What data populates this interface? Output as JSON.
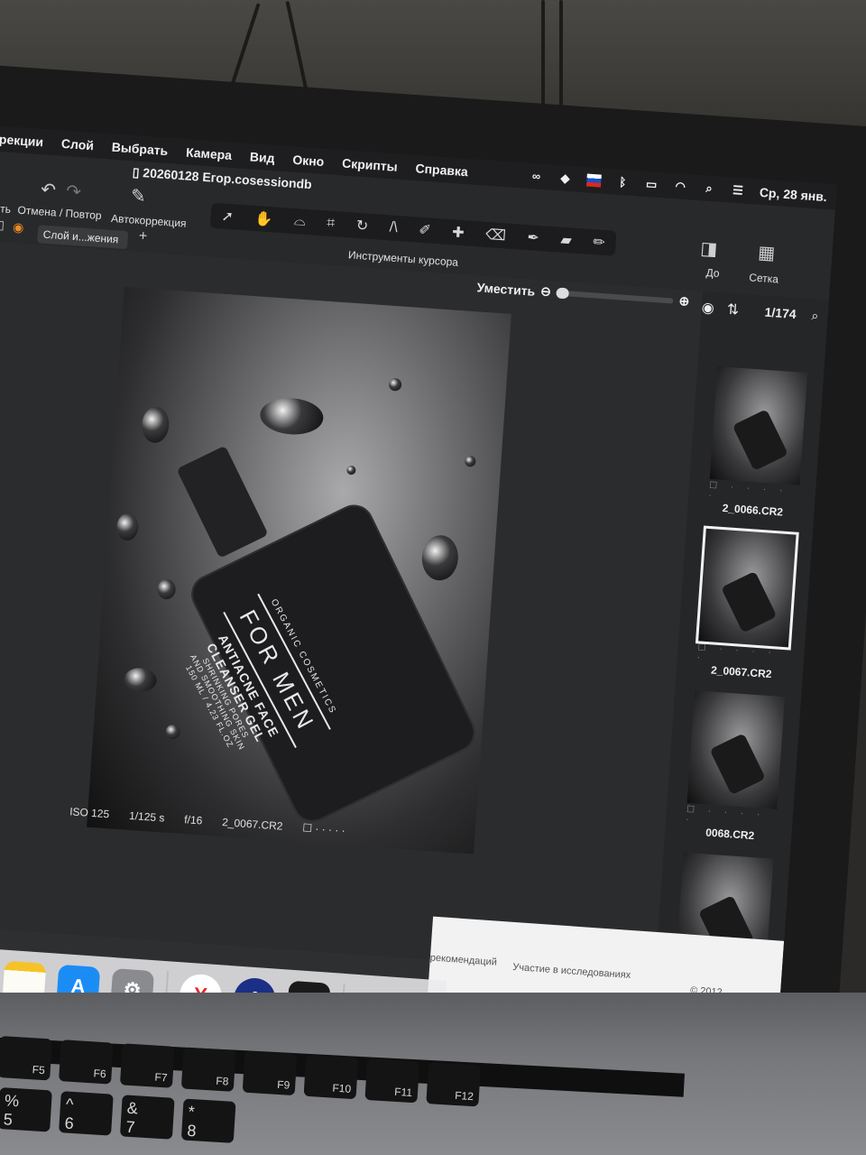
{
  "menubar": {
    "items": [
      "рекции",
      "Слой",
      "Выбрать",
      "Камера",
      "Вид",
      "Окно",
      "Скрипты",
      "Справка"
    ],
    "clock": "Ср, 28 янв."
  },
  "window": {
    "title": "20260128 Егор.cosessiondb"
  },
  "toolbar": {
    "left_fragment": "ить",
    "undo_redo_label": "Отмена / Повтор",
    "autocorrect_label": "Автокоррекция",
    "cursor_tools_label": "Инструменты курсора",
    "layer_select_value": "Слой и...жения",
    "before_label": "До",
    "grid_label": "Сетка"
  },
  "viewer": {
    "zoom_label": "Уместить",
    "counter": "1/174",
    "exif": {
      "iso": "ISO 125",
      "shutter": "1/125 s",
      "aperture": "f/16",
      "filename": "2_0067.CR2"
    }
  },
  "photo": {
    "brand": "ORGANIC COSMETICS",
    "headline": "FOR MEN",
    "product_line1": "ANTIACNE FACE",
    "product_line2": "CLEANSER GEL",
    "claim_line1": "SHRINKING PORES",
    "claim_line2": "AND SMOOTHING SKIN",
    "volume": "150 ML / 4.23 FL.OZ"
  },
  "thumbnails": [
    {
      "name": "2_0066.CR2",
      "selected": false
    },
    {
      "name": "2_0067.CR2",
      "selected": true
    },
    {
      "name": "0068.CR2",
      "selected": false
    },
    {
      "name": "",
      "selected": false
    }
  ],
  "browser_footer": {
    "link1": "рекомендаций",
    "link2": "Участие в исследованиях",
    "copyright": "© 2012–"
  },
  "dock": {
    "apps": [
      "photos-icon",
      "notes-icon",
      "app-store-icon",
      "system-settings-icon",
      "yandex-browser-icon",
      "1password-icon",
      "terminal-icon",
      "trash-icon"
    ]
  },
  "keyboard": {
    "fn_row": [
      "F5",
      "F6",
      "F7",
      "F8",
      "F9",
      "F10",
      "F11",
      "F12"
    ],
    "num_row": [
      {
        "top": "%",
        "bottom": "5"
      },
      {
        "top": "^",
        "bottom": "6"
      },
      {
        "top": "&",
        "bottom": "7"
      },
      {
        "top": "*",
        "bottom": "8"
      }
    ]
  }
}
